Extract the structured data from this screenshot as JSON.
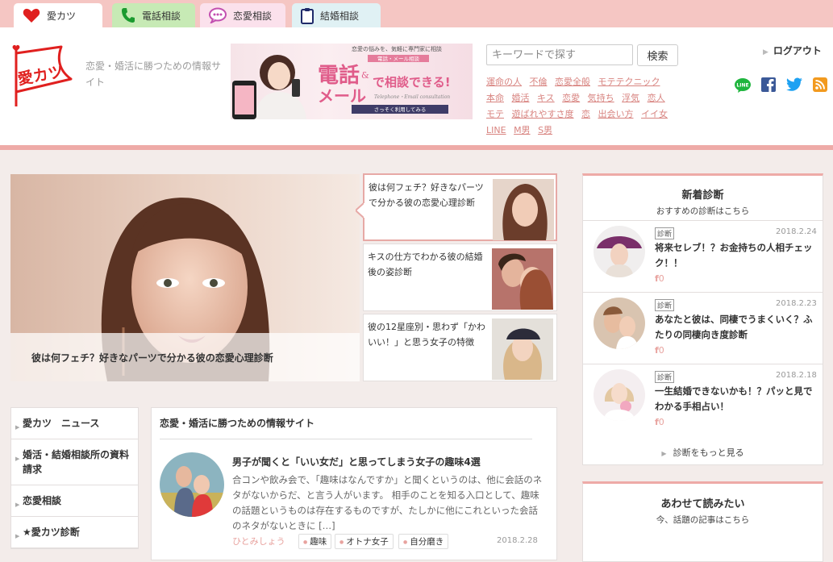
{
  "topnav": {
    "tabs": [
      {
        "label": "愛カツ",
        "icon": "heart-icon"
      },
      {
        "label": "電話相談",
        "icon": "phone-icon"
      },
      {
        "label": "恋愛相談",
        "icon": "chat-bubble-icon"
      },
      {
        "label": "結婚相談",
        "icon": "clipboard-icon"
      }
    ]
  },
  "header": {
    "logo_text": "愛カツ",
    "tagline": "恋愛・婚活に勝つための情報サイト",
    "banner": {
      "small": "恋愛の悩みを、気軽に専門家に相談",
      "sub": "電話・メール相談",
      "headline_1": "電話",
      "headline_amp": "&",
      "headline_2": "メール",
      "headline_3": "で相談できる!",
      "en": "Telephone・Email consultation",
      "cta": "さっそく利用してみる"
    },
    "search": {
      "placeholder": "キーワードで探す",
      "button": "検索"
    },
    "tags": [
      "運命の人",
      "不倫",
      "恋愛全般",
      "モテテクニック",
      "本命",
      "婚活",
      "キス",
      "恋愛",
      "気持ち",
      "浮気",
      "恋人",
      "モテ",
      "遊ばれやすさ度",
      "恋",
      "出会い方",
      "イイ女",
      "LINE",
      "M男",
      "S男"
    ],
    "logout": "ログアウト",
    "social": [
      "line-icon",
      "facebook-icon",
      "twitter-icon",
      "rss-icon"
    ],
    "line_label": "LINE"
  },
  "hero": {
    "caption": "彼は何フェチ？好きなパーツで分かる彼の恋愛心理診断",
    "side": [
      "彼は何フェチ？好きなパーツで分かる彼の恋愛心理診断",
      "キスの仕方でわかる彼の結婚後の姿診断",
      "彼の12星座別・思わず「かわいい！」と思う女子の特徴"
    ]
  },
  "leftnav": [
    "愛カツ　ニュース",
    "婚活・結婚相談所の資料請求",
    "恋愛相談",
    "★愛カツ診断"
  ],
  "main": {
    "title": "恋愛・婚活に勝つための情報サイト",
    "article": {
      "title": "男子が聞くと「いい女だ」と思ってしまう女子の趣味4選",
      "body": "合コンや飲み会で、「趣味はなんですか」と聞くというのは、他に会話のネタがないからだ、と言う人がいます。 相手のことを知る入口として、趣味の話題というものは存在するものですが、たしかに他にこれといった会話のネタがないときに […]",
      "author": "ひとみしょう",
      "tags": [
        "趣味",
        "オトナ女子",
        "自分磨き"
      ],
      "date": "2018.2.28"
    }
  },
  "new_diag": {
    "title": "新着診断",
    "subtitle": "おすすめの診断はこちら",
    "badge": "診断",
    "items": [
      {
        "title": "将来セレブ！？お金持ちの人相チェック！！",
        "date": "2018.2.24",
        "likes": "0"
      },
      {
        "title": "あなたと彼は、同棲でうまくいく？ふたりの同棲向き度診断",
        "date": "2018.2.23",
        "likes": "0"
      },
      {
        "title": "一生結婚できないかも！？パッと見でわかる手相占い！",
        "date": "2018.2.18",
        "likes": "0"
      }
    ],
    "more": "診断をもっと見る"
  },
  "related": {
    "title": "あわせて読みたい",
    "subtitle": "今、話題の記事はこちら"
  },
  "colors": {
    "pink": "#f5c6c3",
    "accent": "#d88480",
    "border": "#eeaaa7"
  }
}
